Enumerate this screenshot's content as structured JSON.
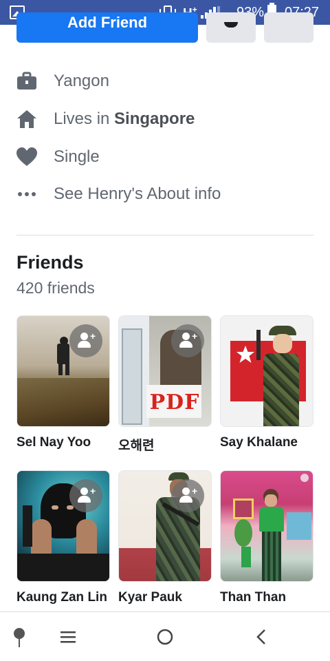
{
  "status_bar": {
    "network": "H",
    "network_plus": "+",
    "battery": "93%",
    "time": "07:27",
    "icons": [
      "gallery-icon",
      "vibrate-icon",
      "signal-icon",
      "battery-icon"
    ]
  },
  "actions": {
    "add_friend_label": "Add Friend",
    "icons": [
      "add-person-icon",
      "messenger-icon",
      "more-icon"
    ]
  },
  "intro": {
    "items": [
      {
        "icon": "briefcase-icon",
        "text": "Yangon",
        "bold": ""
      },
      {
        "icon": "home-icon",
        "text": "Lives in ",
        "bold": "Singapore"
      },
      {
        "icon": "heart-icon",
        "text": "Single",
        "bold": ""
      },
      {
        "icon": "more-dots-icon",
        "text": "See Henry's About info",
        "bold": ""
      }
    ]
  },
  "friends": {
    "title": "Friends",
    "count": "420 friends",
    "list": [
      {
        "name": "Sel Nay Yoo",
        "has_add_badge": true
      },
      {
        "name": "오해련",
        "has_add_badge": true,
        "poster_text": "PDF"
      },
      {
        "name": "Say Khalane",
        "has_add_badge": false
      },
      {
        "name": "Kaung Zan Lin",
        "has_add_badge": true
      },
      {
        "name": "Kyar Pauk",
        "has_add_badge": true
      },
      {
        "name": "Than Than",
        "has_add_badge": false
      }
    ]
  },
  "nav": {
    "icons": [
      "pin-icon",
      "menu-icon",
      "home-circle-icon",
      "back-icon"
    ]
  },
  "colors": {
    "status_bar": "#3b57a4",
    "accent": "#1877f2",
    "icon_gray": "#606770"
  }
}
